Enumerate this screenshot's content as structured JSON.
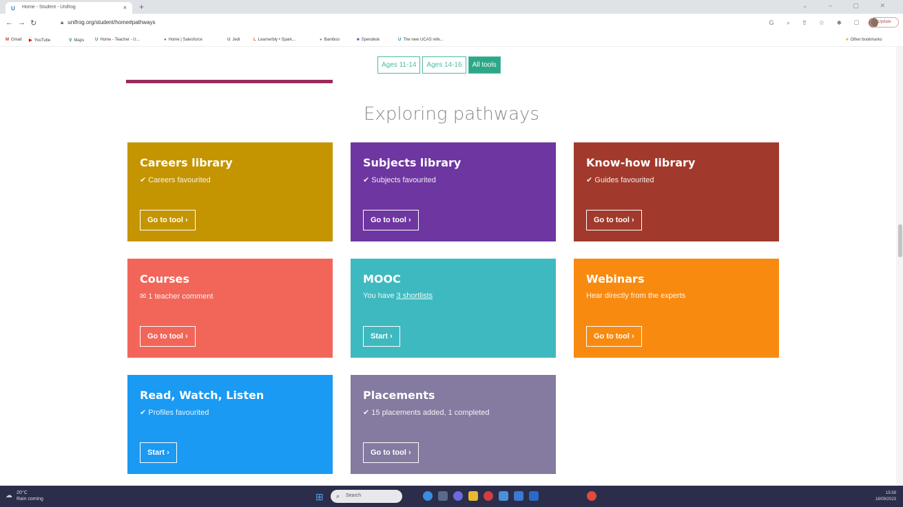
{
  "browser": {
    "tab_title": "Home - Student - Unifrog",
    "tab_close": "×",
    "new_tab": "+",
    "url": "unifrog.org/student/home#pathways",
    "update_label": "Update",
    "bookmarks": [
      {
        "icon": "M",
        "label": "Gmail",
        "color": "#d93025"
      },
      {
        "icon": "▶",
        "label": "YouTube",
        "color": "#e00"
      },
      {
        "icon": "⚲",
        "label": "Maps",
        "color": "#2b8a3e"
      },
      {
        "icon": "U",
        "label": "Home - Teacher - U...",
        "color": "#2a7ab0"
      },
      {
        "icon": "●",
        "label": "Home | Salesforce",
        "color": "#1a82d6"
      },
      {
        "icon": "U",
        "label": "Jedi",
        "color": "#2a7ab0"
      },
      {
        "icon": "L",
        "label": "Learnerbly • Spark...",
        "color": "#e2542a"
      },
      {
        "icon": "●",
        "label": "Bamboo",
        "color": "#6aa33a"
      },
      {
        "icon": "■",
        "label": "Spendesk",
        "color": "#2d55c5"
      },
      {
        "icon": "U",
        "label": "The new UCAS refe...",
        "color": "#2a7ab0"
      }
    ],
    "other_bookmarks": "Other bookmarks"
  },
  "page": {
    "age_tabs": [
      "Ages 11-14",
      "Ages 14-16",
      "All tools"
    ],
    "section_title": "Exploring pathways",
    "cards": [
      {
        "title": "Careers library",
        "sub": "✔ Careers favourited",
        "button": "Go to tool ›",
        "color": "#c49500"
      },
      {
        "title": "Subjects library",
        "sub": "✔ Subjects favourited",
        "button": "Go to tool ›",
        "color": "#6e36a0"
      },
      {
        "title": "Know-how library",
        "sub": "✔ Guides favourited",
        "button": "Go to tool ›",
        "color": "#a13a2c"
      },
      {
        "title": "Courses",
        "sub": "✉ 1 teacher comment",
        "button": "Go to tool ›",
        "color": "#f2665a"
      },
      {
        "title": "MOOC",
        "sub_prefix": "You have ",
        "sub_link": "3 shortlists",
        "button": "Start ›",
        "color": "#3fb9c0"
      },
      {
        "title": "Webinars",
        "sub": "Hear directly from the experts",
        "button": "Go to tool ›",
        "color": "#f98a10"
      },
      {
        "title": "Read, Watch, Listen",
        "sub": "✔ Profiles favourited",
        "button": "Start ›",
        "color": "#1a9af2"
      },
      {
        "title": "Placements",
        "sub": "✔ 15 placements added, 1 completed",
        "button": "Go to tool ›",
        "color": "#857aa0"
      }
    ]
  },
  "taskbar": {
    "weather_temp": "20°C",
    "weather_desc": "Rain coming",
    "search_placeholder": "Search",
    "time": "15:59",
    "date": "18/09/2023"
  }
}
